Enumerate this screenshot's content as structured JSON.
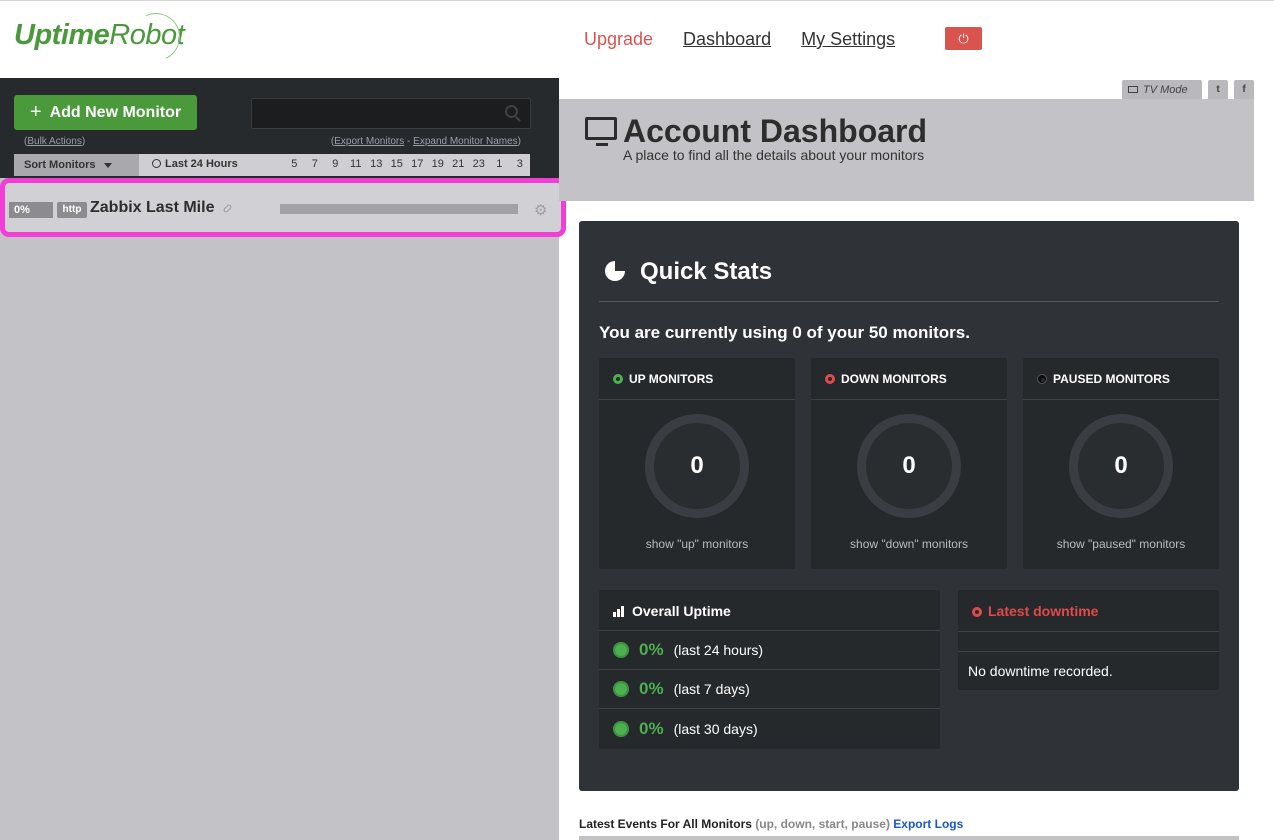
{
  "logo": {
    "part1": "Uptime",
    "part2": "Robot"
  },
  "nav": {
    "upgrade": "Upgrade",
    "dashboard": "Dashboard",
    "settings": "My Settings",
    "power_icon": "power-icon"
  },
  "sidebar": {
    "add_button": "Add New Monitor",
    "search": {
      "placeholder": "",
      "value": ""
    },
    "bulk_actions": "Bulk Actions",
    "export_monitors": "Export Monitors",
    "separator": "-",
    "expand_names": "Expand Monitor Names",
    "sort_label": "Sort Monitors",
    "period_label": "Last 24 Hours",
    "hours": [
      "5",
      "7",
      "9",
      "11",
      "13",
      "15",
      "17",
      "19",
      "21",
      "23",
      "1",
      "3"
    ],
    "monitors": [
      {
        "uptime": "0%",
        "type": "http",
        "name": "Zabbix Last Mile"
      }
    ]
  },
  "header": {
    "tv_mode": "TV Mode",
    "twitter_icon": "twitter-icon",
    "facebook_icon": "facebook-icon",
    "title": "Account Dashboard",
    "subtitle": "A place to find all the details about your monitors"
  },
  "quick_stats": {
    "title": "Quick Stats",
    "usage": "You are currently using 0 of your 50 monitors.",
    "cards": [
      {
        "label": "UP MONITORS",
        "count": "0",
        "link": "show \"up\" monitors",
        "color": "#4caf50"
      },
      {
        "label": "DOWN MONITORS",
        "count": "0",
        "link": "show \"down\" monitors",
        "color": "#e04a4a"
      },
      {
        "label": "PAUSED MONITORS",
        "count": "0",
        "link": "show \"paused\" monitors",
        "color": "#0d0d0d"
      }
    ],
    "overall_uptime": {
      "title": "Overall Uptime",
      "rows": [
        {
          "pct": "0%",
          "label": "(last 24 hours)"
        },
        {
          "pct": "0%",
          "label": "(last 7 days)"
        },
        {
          "pct": "0%",
          "label": "(last 30 days)"
        }
      ]
    },
    "latest_downtime": {
      "title": "Latest downtime",
      "text": "No downtime recorded."
    }
  },
  "events": {
    "title": "Latest Events For All Monitors",
    "filters": "(up, down, start, pause)",
    "export": "Export Logs"
  }
}
